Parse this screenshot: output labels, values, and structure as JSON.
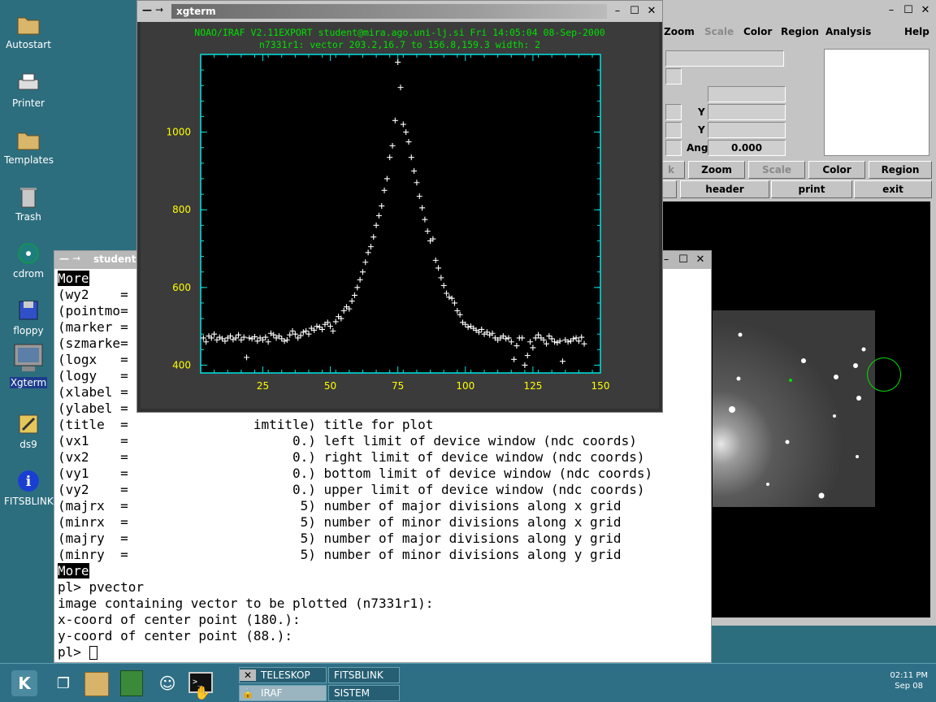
{
  "desktop": {
    "icons": [
      {
        "name": "autostart",
        "label": "Autostart",
        "icon": "folder-icon"
      },
      {
        "name": "printer",
        "label": "Printer",
        "icon": "printer-icon"
      },
      {
        "name": "templates",
        "label": "Templates",
        "icon": "folder-icon"
      },
      {
        "name": "trash",
        "label": "Trash",
        "icon": "trash-icon"
      },
      {
        "name": "cdrom",
        "label": "cdrom",
        "icon": "cdrom-icon"
      },
      {
        "name": "floppy",
        "label": "floppy",
        "icon": "floppy-icon"
      },
      {
        "name": "xgterm",
        "label": "Xgterm",
        "icon": "monitor-icon"
      },
      {
        "name": "ds9",
        "label": "ds9",
        "icon": "ds9-icon"
      },
      {
        "name": "fitsblink",
        "label": "FITSBLINK",
        "icon": "info-icon"
      }
    ]
  },
  "ds9": {
    "menu": [
      "Zoom",
      "Scale",
      "Color",
      "Region",
      "Analysis",
      "Help"
    ],
    "labels": {
      "y1": "Y",
      "y2": "Y",
      "ang": "Ang",
      "ang_value": "0.000"
    },
    "buttons_row1": [
      "k",
      "Zoom",
      "Scale",
      "Color",
      "Region"
    ],
    "buttons_row2": [
      "header",
      "print",
      "exit"
    ]
  },
  "terminal": {
    "title": "student@",
    "lines": [
      {
        "text": "More",
        "hl": true
      },
      {
        "text": "(wy2    ="
      },
      {
        "text": "(pointmo="
      },
      {
        "text": "(marker ="
      },
      {
        "text": "(szmarke="
      },
      {
        "text": "(logx   ="
      },
      {
        "text": "(logy   ="
      },
      {
        "text": "(xlabel ="
      },
      {
        "text": "(ylabel ="
      },
      {
        "text": "(title  =                imtitle) title for plot"
      },
      {
        "text": "(vx1    =                     0.) left limit of device window (ndc coords)"
      },
      {
        "text": "(vx2    =                     0.) right limit of device window (ndc coords)"
      },
      {
        "text": "(vy1    =                     0.) bottom limit of device window (ndc coords)"
      },
      {
        "text": "(vy2    =                     0.) upper limit of device window (ndc coords)"
      },
      {
        "text": "(majrx  =                      5) number of major divisions along x grid"
      },
      {
        "text": "(minrx  =                      5) number of minor divisions along x grid"
      },
      {
        "text": "(majry  =                      5) number of major divisions along y grid"
      },
      {
        "text": "(minry  =                      5) number of minor divisions along y grid"
      },
      {
        "text": "More",
        "hl": true
      },
      {
        "text": "pl> pvector"
      },
      {
        "text": "image containing vector to be plotted (n7331r1):"
      },
      {
        "text": "x-coord of center point (180.):"
      },
      {
        "text": "y-coord of center point (88.):"
      },
      {
        "text": "pl> "
      }
    ]
  },
  "xgterm": {
    "title": "xgterm",
    "header1": "NOAO/IRAF V2.11EXPORT student@mira.ago.uni-lj.si Fri 14:05:04 08-Sep-2000",
    "header2": "n7331r1: vector 203.2,16.7 to 156.8,159.3 width: 2"
  },
  "chart_data": {
    "type": "scatter",
    "title": "",
    "xlabel": "",
    "ylabel": "",
    "xlim": [
      2,
      150
    ],
    "ylim": [
      380,
      1200
    ],
    "xticks": [
      25,
      50,
      75,
      100,
      125,
      150
    ],
    "yticks": [
      400,
      600,
      800,
      1000
    ],
    "colors": {
      "axis": "#00e5e5",
      "ticklabel": "#ffff00",
      "marker": "#ffffff",
      "header": "#00e000"
    },
    "x": [
      3,
      4,
      5,
      6,
      7,
      8,
      9,
      10,
      11,
      12,
      13,
      14,
      15,
      16,
      17,
      18,
      19,
      20,
      21,
      22,
      23,
      24,
      25,
      26,
      27,
      28,
      29,
      30,
      31,
      32,
      33,
      34,
      35,
      36,
      37,
      38,
      39,
      40,
      41,
      42,
      43,
      44,
      45,
      46,
      47,
      48,
      49,
      50,
      51,
      52,
      53,
      54,
      55,
      56,
      57,
      58,
      59,
      60,
      61,
      62,
      63,
      64,
      65,
      66,
      67,
      68,
      69,
      70,
      71,
      72,
      73,
      74,
      75,
      76,
      77,
      78,
      79,
      80,
      81,
      82,
      83,
      84,
      85,
      86,
      87,
      88,
      89,
      90,
      91,
      92,
      93,
      94,
      95,
      96,
      97,
      98,
      99,
      100,
      101,
      102,
      103,
      104,
      105,
      106,
      107,
      108,
      109,
      110,
      111,
      112,
      113,
      114,
      115,
      116,
      117,
      118,
      119,
      120,
      121,
      122,
      123,
      124,
      125,
      126,
      127,
      128,
      129,
      130,
      131,
      132,
      133,
      134,
      135,
      136,
      137,
      138,
      139,
      140,
      141,
      142,
      143,
      144,
      145,
      146,
      147,
      148,
      149,
      150
    ],
    "y": [
      470,
      460,
      475,
      470,
      480,
      465,
      472,
      468,
      462,
      470,
      475,
      466,
      470,
      478,
      465,
      472,
      420,
      470,
      468,
      473,
      462,
      470,
      465,
      472,
      460,
      482,
      478,
      470,
      475,
      468,
      462,
      465,
      478,
      488,
      480,
      470,
      476,
      485,
      488,
      480,
      495,
      490,
      500,
      498,
      492,
      505,
      510,
      500,
      488,
      512,
      525,
      520,
      540,
      550,
      545,
      565,
      580,
      600,
      620,
      640,
      665,
      690,
      705,
      730,
      760,
      785,
      810,
      850,
      880,
      935,
      965,
      1030,
      1180,
      1115,
      1020,
      1000,
      975,
      935,
      900,
      870,
      835,
      805,
      775,
      745,
      720,
      725,
      670,
      650,
      625,
      605,
      585,
      575,
      572,
      560,
      540,
      530,
      510,
      505,
      498,
      500,
      495,
      490,
      485,
      492,
      480,
      485,
      478,
      482,
      470,
      465,
      470,
      475,
      468,
      470,
      460,
      415,
      450,
      470,
      470,
      400,
      425,
      460,
      445,
      470,
      478,
      470,
      465,
      455,
      475,
      468,
      460,
      458,
      462,
      410,
      465,
      460,
      462,
      468,
      470,
      462,
      472,
      455
    ]
  },
  "taskbar": {
    "tasks": [
      {
        "label": "TELESKOP",
        "icon": "close-x-icon"
      },
      {
        "label": "FITSBLINK"
      },
      {
        "label": "IRAF",
        "icon": "lock-icon"
      },
      {
        "label": "SISTEM"
      }
    ],
    "clock": {
      "time": "02:11 PM",
      "date": "Sep 08"
    },
    "colors": {
      "bar": "#2e6f86",
      "task": "#265f73"
    }
  }
}
